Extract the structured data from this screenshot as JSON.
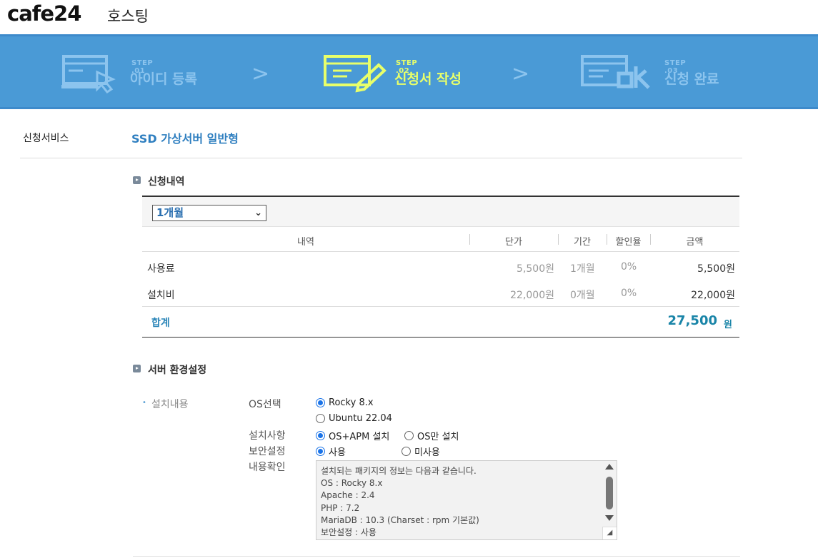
{
  "header": {
    "logo": "cafe24",
    "title": "호스팅"
  },
  "steps": [
    {
      "no": "STEP .01",
      "title": "아이디 등록",
      "state": "done",
      "icon": "screen-cursor-icon"
    },
    {
      "no": "STEP .02",
      "title": "신청서 작성",
      "state": "active",
      "icon": "form-pencil-icon"
    },
    {
      "no": "STEP .03",
      "title": "신청 완료",
      "state": "pending",
      "icon": "screen-ok-icon"
    }
  ],
  "service": {
    "label": "신청서비스",
    "value": "SSD 가상서버 일반형"
  },
  "order": {
    "section_title": "신청내역",
    "period": "1개월",
    "columns": [
      "내역",
      "단가",
      "기간",
      "할인율",
      "금액"
    ],
    "rows": [
      {
        "item": "사용료",
        "unit_price": "5,500원",
        "period": "1개월",
        "discount": "0%",
        "amount": "5,500원"
      },
      {
        "item": "설치비",
        "unit_price": "22,000원",
        "period": "0개월",
        "discount": "0%",
        "amount": "22,000원"
      }
    ],
    "total_label": "합계",
    "total_value": "27,500",
    "total_unit": "원"
  },
  "env": {
    "section_title": "서버 환경설정",
    "install_label": "설치내용",
    "os_label": "OS선택",
    "os_options": [
      "Rocky 8.x",
      "Ubuntu 22.04"
    ],
    "os_selected": 0,
    "install_type_label": "설치사항",
    "install_options": [
      "OS+APM 설치",
      "OS만 설치"
    ],
    "install_selected": 0,
    "security_label": "보안설정",
    "security_options": [
      "사용",
      "미사용"
    ],
    "security_selected": 0,
    "confirm_label": "내용확인",
    "info_lines": [
      "설치되는 패키지의 정보는 다음과 같습니다.",
      "OS : Rocky 8.x",
      "Apache : 2.4",
      "PHP : 7.2",
      "MariaDB : 10.3 (Charset : rpm 기본값)",
      "보안설정 : 사용"
    ]
  },
  "colors": {
    "banner": "#4a9ad6",
    "active_step": "#e8ff6a",
    "accent": "#2f7fc0",
    "total": "#1a85a8"
  }
}
